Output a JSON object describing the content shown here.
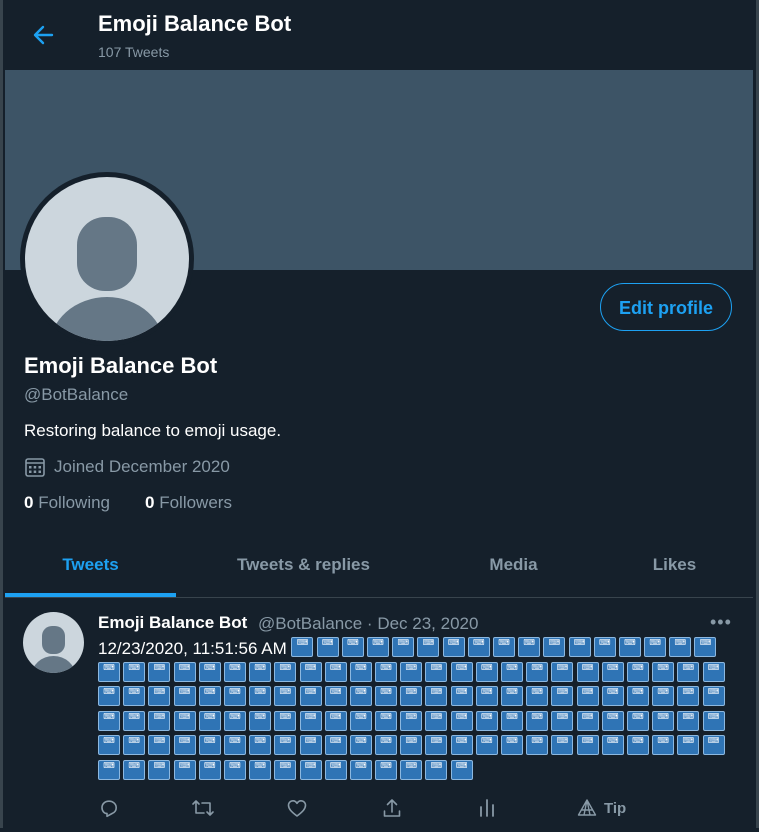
{
  "header": {
    "title": "Emoji Balance Bot",
    "tweet_count": "107 Tweets"
  },
  "profile": {
    "name": "Emoji Balance Bot",
    "handle": "@BotBalance",
    "bio": "Restoring balance to emoji usage.",
    "joined": "Joined December 2020",
    "following_count": "0",
    "following_label": "Following",
    "followers_count": "0",
    "followers_label": "Followers",
    "edit_label": "Edit profile"
  },
  "tabs": [
    {
      "label": "Tweets",
      "active": true
    },
    {
      "label": "Tweets & replies",
      "active": false
    },
    {
      "label": "Media",
      "active": false
    },
    {
      "label": "Likes",
      "active": false
    }
  ],
  "tweet": {
    "name": "Emoji Balance Bot",
    "handle_date": "@BotBalance · Dec 23, 2020",
    "text": "12/23/2020, 11:51:56 AM",
    "emoji_name": "input-symbols-emoji",
    "emoji_glyph": "⌨",
    "emoji_count": 132,
    "more": "•••",
    "tip_label": "Tip"
  },
  "icons": {
    "back": "arrow-left-icon",
    "calendar": "calendar-icon",
    "reply": "reply-icon",
    "retweet": "retweet-icon",
    "like": "heart-icon",
    "share": "share-icon",
    "analytics": "analytics-icon",
    "tip": "tip-icon"
  },
  "colors": {
    "background": "#15202b",
    "accent": "#1da1f2",
    "secondary_text": "#8899a6",
    "banner": "#3d5466"
  }
}
